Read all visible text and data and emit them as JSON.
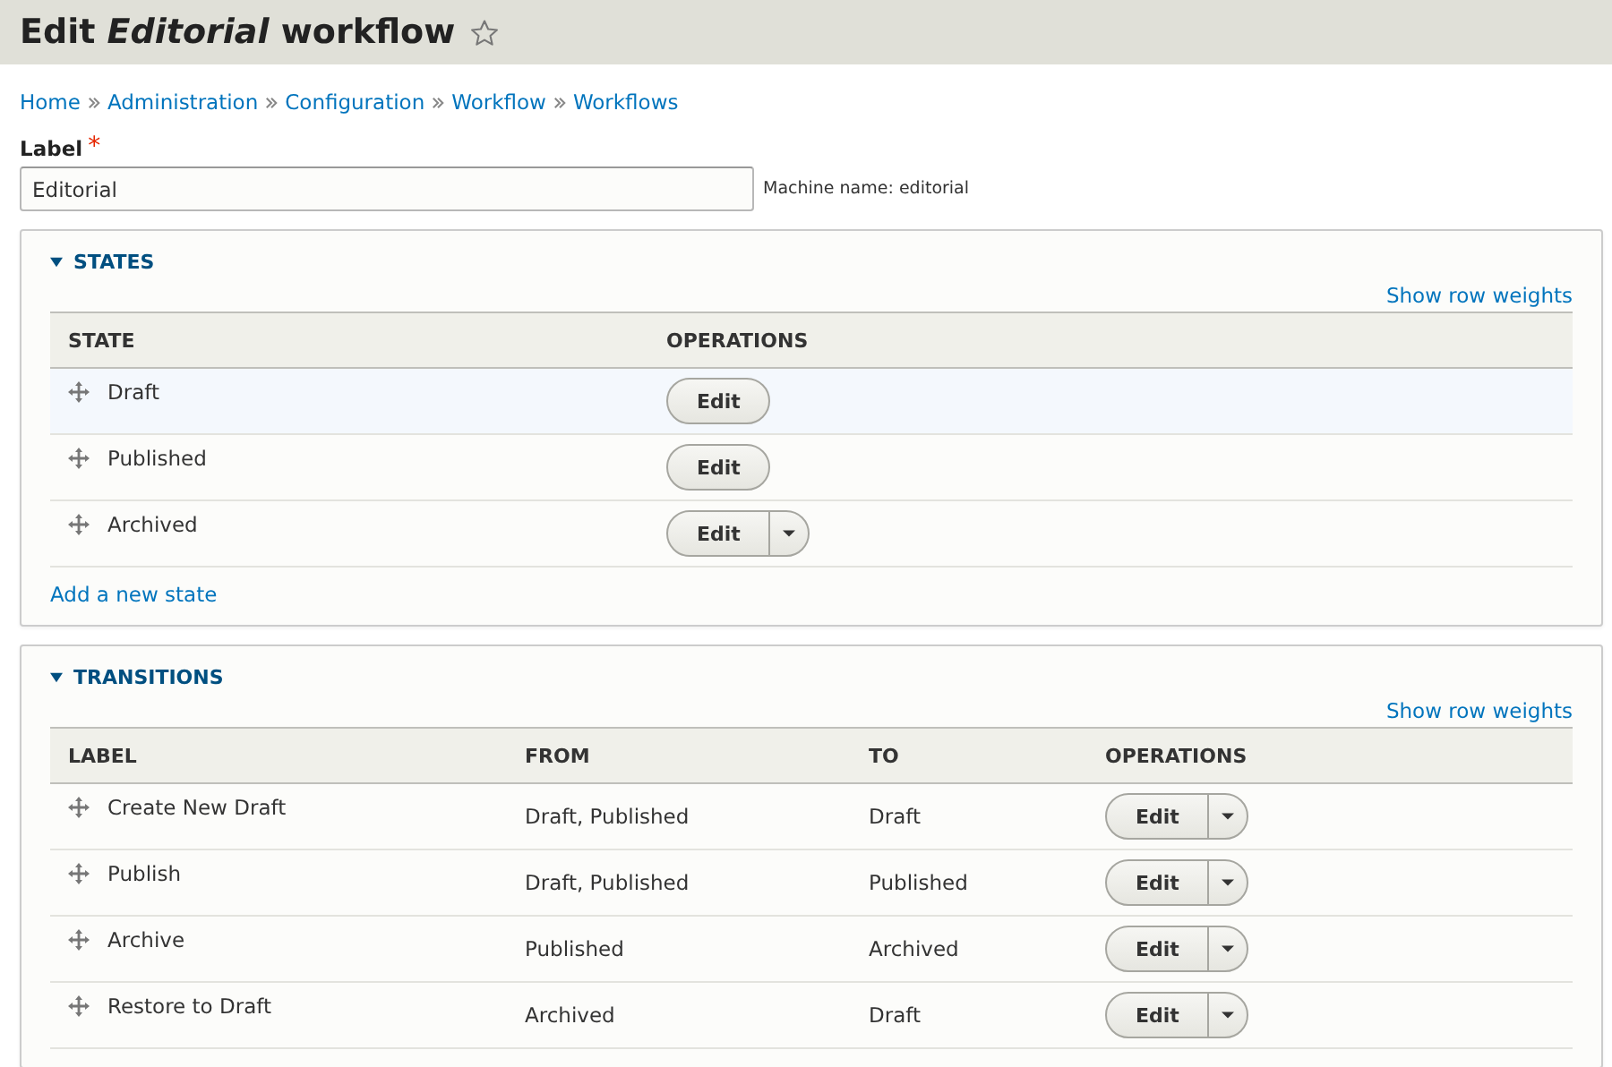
{
  "header": {
    "title": "Edit *Editorial* workflow"
  },
  "breadcrumb": [
    "Home",
    "Administration",
    "Configuration",
    "Workflow",
    "Workflows"
  ],
  "label_field": {
    "label": "Label",
    "required_mark": "*",
    "value": "Editorial",
    "machine_name": "Machine name: editorial"
  },
  "sections": [
    {
      "title": "STATES",
      "expanded": true,
      "show_weights_link": "Show row weights",
      "columns": [
        "STATE",
        "OPERATIONS"
      ],
      "rows": [
        {
          "cells": [
            "Draft"
          ],
          "highlighted": true,
          "operation": {
            "label": "Edit",
            "has_dropdown": false
          }
        },
        {
          "cells": [
            "Published"
          ],
          "highlighted": false,
          "operation": {
            "label": "Edit",
            "has_dropdown": false
          }
        },
        {
          "cells": [
            "Archived"
          ],
          "highlighted": false,
          "operation": {
            "label": "Edit",
            "has_dropdown": true
          }
        }
      ],
      "add_link": "Add a new state"
    },
    {
      "title": "TRANSITIONS",
      "expanded": true,
      "show_weights_link": "Show row weights",
      "columns": [
        "LABEL",
        "FROM",
        "TO",
        "OPERATIONS"
      ],
      "rows": [
        {
          "cells": [
            "Create New Draft",
            "Draft, Published",
            "Draft"
          ],
          "highlighted": false,
          "operation": {
            "label": "Edit",
            "has_dropdown": true
          }
        },
        {
          "cells": [
            "Publish",
            "Draft, Published",
            "Published"
          ],
          "highlighted": false,
          "operation": {
            "label": "Edit",
            "has_dropdown": true
          }
        },
        {
          "cells": [
            "Archive",
            "Published",
            "Archived"
          ],
          "highlighted": false,
          "operation": {
            "label": "Edit",
            "has_dropdown": true
          }
        },
        {
          "cells": [
            "Restore to Draft",
            "Archived",
            "Draft"
          ],
          "highlighted": false,
          "operation": {
            "label": "Edit",
            "has_dropdown": true
          }
        }
      ]
    }
  ]
}
